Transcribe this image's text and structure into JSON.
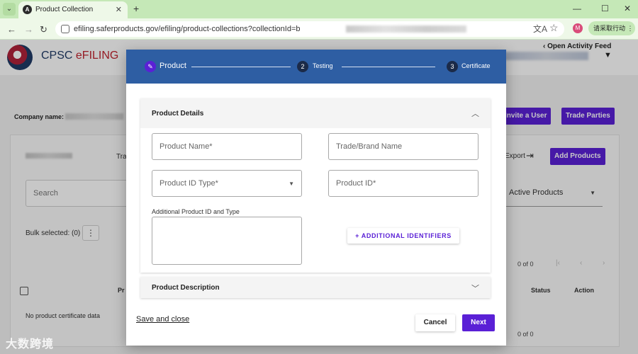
{
  "browser": {
    "tab_title": "Product Collection",
    "tab_favicon": "A",
    "close_glyph": "✕",
    "new_tab_glyph": "+",
    "url": "efiling.saferproducts.gov/efiling/product-collections?collectionId=b",
    "profile_initial": "M",
    "profile_label": "请采取行动 ⋮"
  },
  "app": {
    "brand_prefix": "CPSC ",
    "brand_suffix": "eFILING",
    "activity_feed": "‹  Open Activity Feed",
    "company_label": "Company name:",
    "invite_user": "Invite a User",
    "trade_parties": "Trade Parties",
    "tra_fragment": "Tra",
    "export": "Export",
    "add_products": "Add Products",
    "search_placeholder": "Search",
    "active_products": "Active Products",
    "bulk_selected": "Bulk selected: (0)",
    "pager_count": "0 of 0",
    "col_pr": "Pr",
    "col_status": "Status",
    "col_action": "Action",
    "empty": "No product certificate data",
    "pager_count_2": "0 of 0"
  },
  "modal": {
    "steps": [
      {
        "badge": "✎",
        "label": "Product"
      },
      {
        "badge": "2",
        "label": "Testing"
      },
      {
        "badge": "3",
        "label": "Certificate"
      }
    ],
    "details_title": "Product Details",
    "product_name": "Product Name*",
    "brand_name": "Trade/Brand Name",
    "product_id_type": "Product ID Type*",
    "product_id": "Product ID*",
    "additional_label": "Additional Product ID and Type",
    "additional_button": "+ ADDITIONAL IDENTIFIERS",
    "description_title": "Product Description",
    "save_close": "Save and close",
    "cancel": "Cancel",
    "next": "Next"
  },
  "watermark": "大数跨境",
  "colors": {
    "accent": "#5a20d6",
    "stepper": "#2e5ea3",
    "brand_red": "#c0232f"
  }
}
